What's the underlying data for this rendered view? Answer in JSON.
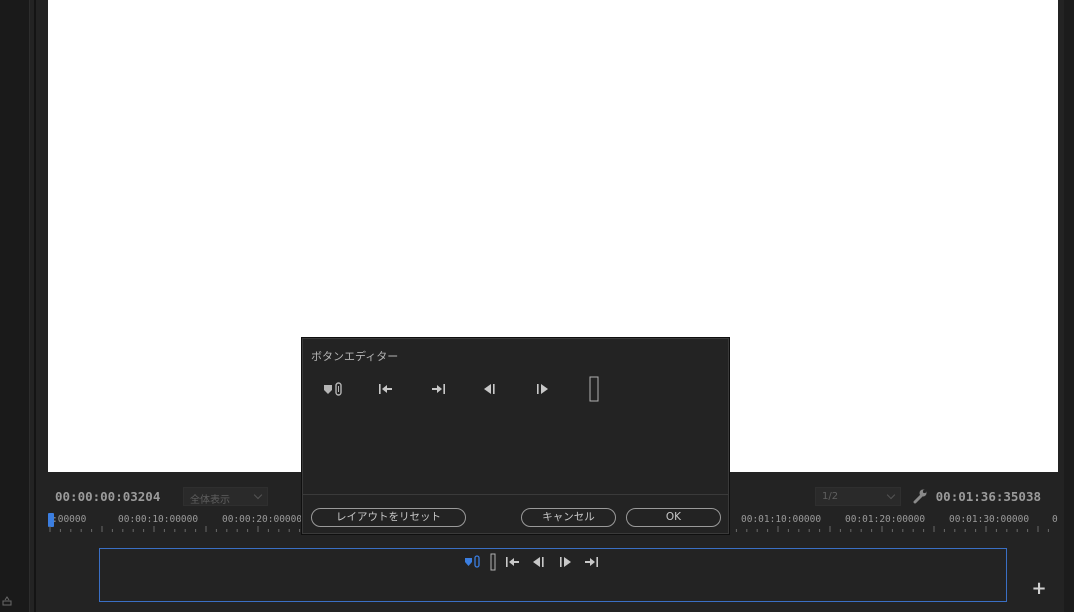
{
  "monitor": {
    "timecode_current": "00:00:00:03204",
    "timecode_duration": "00:01:36:35038",
    "zoom_select": "全体表示",
    "resolution_select": "1/2"
  },
  "ruler": {
    "labels": [
      ":00000",
      "00:00:10:00000",
      "00:00:20:00000",
      "00:01:10:00000",
      "00:01:20:00000",
      "00:01:30:00000",
      "0"
    ]
  },
  "dialog": {
    "title": "ボタンエディター",
    "reset_label": "レイアウトをリセット",
    "cancel_label": "キャンセル",
    "ok_label": "OK",
    "icons": [
      "marker-link-icon",
      "go-to-in-icon",
      "go-to-out-icon",
      "step-back-icon",
      "step-forward-icon",
      "spacer-icon"
    ]
  },
  "button_bar": {
    "icons": [
      "marker-link-icon",
      "spacer-icon",
      "go-to-in-icon",
      "step-back-icon",
      "step-forward-icon",
      "go-to-out-icon"
    ],
    "add_label": "+"
  },
  "colors": {
    "accent": "#3b7ee0",
    "panel_bg": "#232323",
    "monitor_bg": "#ffffff"
  }
}
